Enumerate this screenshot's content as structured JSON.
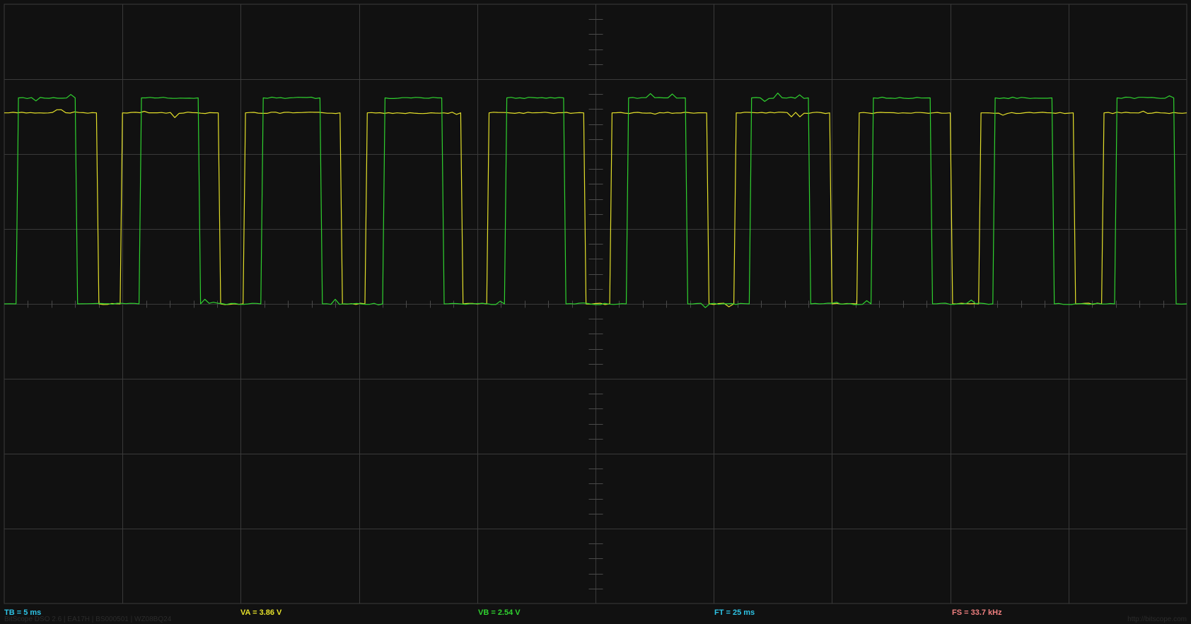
{
  "app": {
    "footer_left": "BitScope DSO 2.6 | EA17H | BS000501 | WZ08BQ24",
    "footer_right": "http://bitscope.com"
  },
  "readouts": {
    "tb": "TB = 5 ms",
    "va": "VA = 3.86 V",
    "vb": "VB = 2.54 V",
    "ft": "FT = 25 ms",
    "fs": "FS = 33.7 kHz"
  },
  "colors": {
    "background": "#111111",
    "grid": "#3a3a3a",
    "channel_a": "#e4e02a",
    "channel_b": "#2fd22f",
    "tb_readout": "#2ec4e6",
    "va_readout": "#e4e02a",
    "vb_readout": "#2fd22f",
    "ft_readout": "#2ec4e6",
    "fs_readout": "#f08080"
  },
  "chart_data": {
    "type": "line",
    "grid": true,
    "x_divisions": 10,
    "y_divisions": 8,
    "xlim": [
      0,
      10
    ],
    "ylim": [
      -4,
      4
    ],
    "series": [
      {
        "channel": "A",
        "color": "#e4e02a",
        "x": [
          0.0,
          0.78,
          0.8,
          0.98,
          1.0,
          1.81,
          1.83,
          2.02,
          2.04,
          2.84,
          2.86,
          3.05,
          3.07,
          3.86,
          3.88,
          4.08,
          4.1,
          4.9,
          4.92,
          5.12,
          5.14,
          5.94,
          5.96,
          6.17,
          6.19,
          6.98,
          7.0,
          7.21,
          7.23,
          8.0,
          8.02,
          8.24,
          8.26,
          9.04,
          9.06,
          9.28,
          9.3,
          10.0
        ],
        "y": [
          2.55,
          2.55,
          0.0,
          0.0,
          2.55,
          2.55,
          0.0,
          0.0,
          2.55,
          2.55,
          0.0,
          0.0,
          2.55,
          2.55,
          0.0,
          0.0,
          2.55,
          2.55,
          0.0,
          0.0,
          2.55,
          2.55,
          0.0,
          0.0,
          2.55,
          2.55,
          0.0,
          0.0,
          2.55,
          2.55,
          0.0,
          0.0,
          2.55,
          2.55,
          0.0,
          0.0,
          2.55,
          2.55
        ]
      },
      {
        "channel": "B",
        "color": "#2fd22f",
        "x": [
          0.0,
          0.1,
          0.12,
          0.6,
          0.62,
          1.14,
          1.16,
          1.64,
          1.66,
          2.17,
          2.19,
          2.67,
          2.69,
          3.2,
          3.22,
          3.7,
          3.72,
          4.23,
          4.25,
          4.73,
          4.75,
          5.26,
          5.28,
          5.76,
          5.78,
          6.3,
          6.32,
          6.8,
          6.82,
          7.33,
          7.35,
          7.83,
          7.85,
          8.36,
          8.38,
          8.86,
          8.88,
          9.39,
          9.41,
          9.89,
          9.91,
          10.0
        ],
        "y": [
          0.0,
          0.0,
          2.75,
          2.75,
          0.0,
          0.0,
          2.75,
          2.75,
          0.0,
          0.0,
          2.75,
          2.75,
          0.0,
          0.0,
          2.75,
          2.75,
          0.0,
          0.0,
          2.75,
          2.75,
          0.0,
          0.0,
          2.75,
          2.75,
          0.0,
          0.0,
          2.75,
          2.75,
          0.0,
          0.0,
          2.75,
          2.75,
          0.0,
          0.0,
          2.75,
          2.75,
          0.0,
          0.0,
          2.75,
          2.75,
          0.0,
          0.0
        ]
      }
    ]
  }
}
